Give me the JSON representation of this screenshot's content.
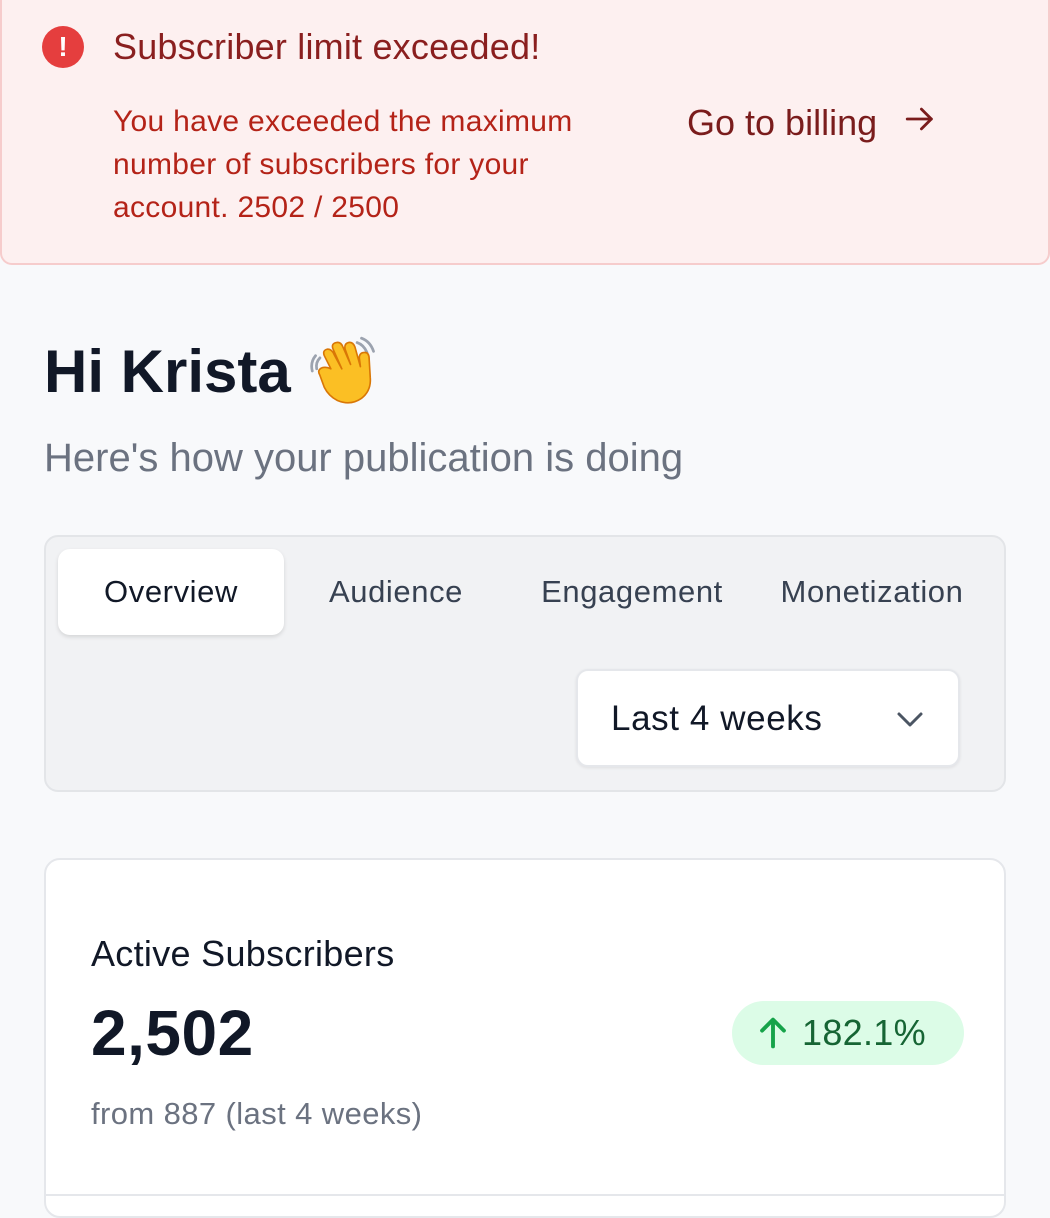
{
  "alert": {
    "icon": "exclamation-circle-icon",
    "icon_glyph": "!",
    "title": "Subscriber limit exceeded!",
    "message": "You have exceeded the maximum number of subscribers for your account. 2502 / 2500",
    "action_label": "Go to billing",
    "background": "#fdf0f0",
    "accent": "#e53e3e"
  },
  "header": {
    "greeting": "Hi Krista",
    "greeting_emoji": "waving-hand-icon",
    "subheading": "Here's how your publication is doing"
  },
  "tabs": [
    {
      "label": "Overview",
      "active": true
    },
    {
      "label": "Audience",
      "active": false
    },
    {
      "label": "Engagement",
      "active": false
    },
    {
      "label": "Monetization",
      "active": false
    }
  ],
  "date_range": {
    "selected": "Last 4 weeks",
    "icon": "chevron-down-icon"
  },
  "metric_card": {
    "title": "Active Subscribers",
    "value": "2,502",
    "change": "182.1%",
    "change_direction": "up",
    "change_color": "#16a34a",
    "subtext": "from 887 (last 4 weeks)"
  }
}
